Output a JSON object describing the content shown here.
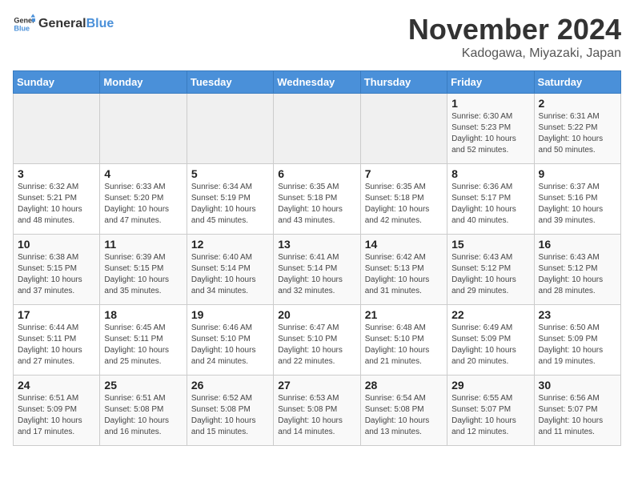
{
  "header": {
    "logo_general": "General",
    "logo_blue": "Blue",
    "month_title": "November 2024",
    "location": "Kadogawa, Miyazaki, Japan"
  },
  "weekdays": [
    "Sunday",
    "Monday",
    "Tuesday",
    "Wednesday",
    "Thursday",
    "Friday",
    "Saturday"
  ],
  "weeks": [
    [
      {
        "day": "",
        "detail": ""
      },
      {
        "day": "",
        "detail": ""
      },
      {
        "day": "",
        "detail": ""
      },
      {
        "day": "",
        "detail": ""
      },
      {
        "day": "",
        "detail": ""
      },
      {
        "day": "1",
        "detail": "Sunrise: 6:30 AM\nSunset: 5:23 PM\nDaylight: 10 hours\nand 52 minutes."
      },
      {
        "day": "2",
        "detail": "Sunrise: 6:31 AM\nSunset: 5:22 PM\nDaylight: 10 hours\nand 50 minutes."
      }
    ],
    [
      {
        "day": "3",
        "detail": "Sunrise: 6:32 AM\nSunset: 5:21 PM\nDaylight: 10 hours\nand 48 minutes."
      },
      {
        "day": "4",
        "detail": "Sunrise: 6:33 AM\nSunset: 5:20 PM\nDaylight: 10 hours\nand 47 minutes."
      },
      {
        "day": "5",
        "detail": "Sunrise: 6:34 AM\nSunset: 5:19 PM\nDaylight: 10 hours\nand 45 minutes."
      },
      {
        "day": "6",
        "detail": "Sunrise: 6:35 AM\nSunset: 5:18 PM\nDaylight: 10 hours\nand 43 minutes."
      },
      {
        "day": "7",
        "detail": "Sunrise: 6:35 AM\nSunset: 5:18 PM\nDaylight: 10 hours\nand 42 minutes."
      },
      {
        "day": "8",
        "detail": "Sunrise: 6:36 AM\nSunset: 5:17 PM\nDaylight: 10 hours\nand 40 minutes."
      },
      {
        "day": "9",
        "detail": "Sunrise: 6:37 AM\nSunset: 5:16 PM\nDaylight: 10 hours\nand 39 minutes."
      }
    ],
    [
      {
        "day": "10",
        "detail": "Sunrise: 6:38 AM\nSunset: 5:15 PM\nDaylight: 10 hours\nand 37 minutes."
      },
      {
        "day": "11",
        "detail": "Sunrise: 6:39 AM\nSunset: 5:15 PM\nDaylight: 10 hours\nand 35 minutes."
      },
      {
        "day": "12",
        "detail": "Sunrise: 6:40 AM\nSunset: 5:14 PM\nDaylight: 10 hours\nand 34 minutes."
      },
      {
        "day": "13",
        "detail": "Sunrise: 6:41 AM\nSunset: 5:14 PM\nDaylight: 10 hours\nand 32 minutes."
      },
      {
        "day": "14",
        "detail": "Sunrise: 6:42 AM\nSunset: 5:13 PM\nDaylight: 10 hours\nand 31 minutes."
      },
      {
        "day": "15",
        "detail": "Sunrise: 6:43 AM\nSunset: 5:12 PM\nDaylight: 10 hours\nand 29 minutes."
      },
      {
        "day": "16",
        "detail": "Sunrise: 6:43 AM\nSunset: 5:12 PM\nDaylight: 10 hours\nand 28 minutes."
      }
    ],
    [
      {
        "day": "17",
        "detail": "Sunrise: 6:44 AM\nSunset: 5:11 PM\nDaylight: 10 hours\nand 27 minutes."
      },
      {
        "day": "18",
        "detail": "Sunrise: 6:45 AM\nSunset: 5:11 PM\nDaylight: 10 hours\nand 25 minutes."
      },
      {
        "day": "19",
        "detail": "Sunrise: 6:46 AM\nSunset: 5:10 PM\nDaylight: 10 hours\nand 24 minutes."
      },
      {
        "day": "20",
        "detail": "Sunrise: 6:47 AM\nSunset: 5:10 PM\nDaylight: 10 hours\nand 22 minutes."
      },
      {
        "day": "21",
        "detail": "Sunrise: 6:48 AM\nSunset: 5:10 PM\nDaylight: 10 hours\nand 21 minutes."
      },
      {
        "day": "22",
        "detail": "Sunrise: 6:49 AM\nSunset: 5:09 PM\nDaylight: 10 hours\nand 20 minutes."
      },
      {
        "day": "23",
        "detail": "Sunrise: 6:50 AM\nSunset: 5:09 PM\nDaylight: 10 hours\nand 19 minutes."
      }
    ],
    [
      {
        "day": "24",
        "detail": "Sunrise: 6:51 AM\nSunset: 5:09 PM\nDaylight: 10 hours\nand 17 minutes."
      },
      {
        "day": "25",
        "detail": "Sunrise: 6:51 AM\nSunset: 5:08 PM\nDaylight: 10 hours\nand 16 minutes."
      },
      {
        "day": "26",
        "detail": "Sunrise: 6:52 AM\nSunset: 5:08 PM\nDaylight: 10 hours\nand 15 minutes."
      },
      {
        "day": "27",
        "detail": "Sunrise: 6:53 AM\nSunset: 5:08 PM\nDaylight: 10 hours\nand 14 minutes."
      },
      {
        "day": "28",
        "detail": "Sunrise: 6:54 AM\nSunset: 5:08 PM\nDaylight: 10 hours\nand 13 minutes."
      },
      {
        "day": "29",
        "detail": "Sunrise: 6:55 AM\nSunset: 5:07 PM\nDaylight: 10 hours\nand 12 minutes."
      },
      {
        "day": "30",
        "detail": "Sunrise: 6:56 AM\nSunset: 5:07 PM\nDaylight: 10 hours\nand 11 minutes."
      }
    ]
  ]
}
